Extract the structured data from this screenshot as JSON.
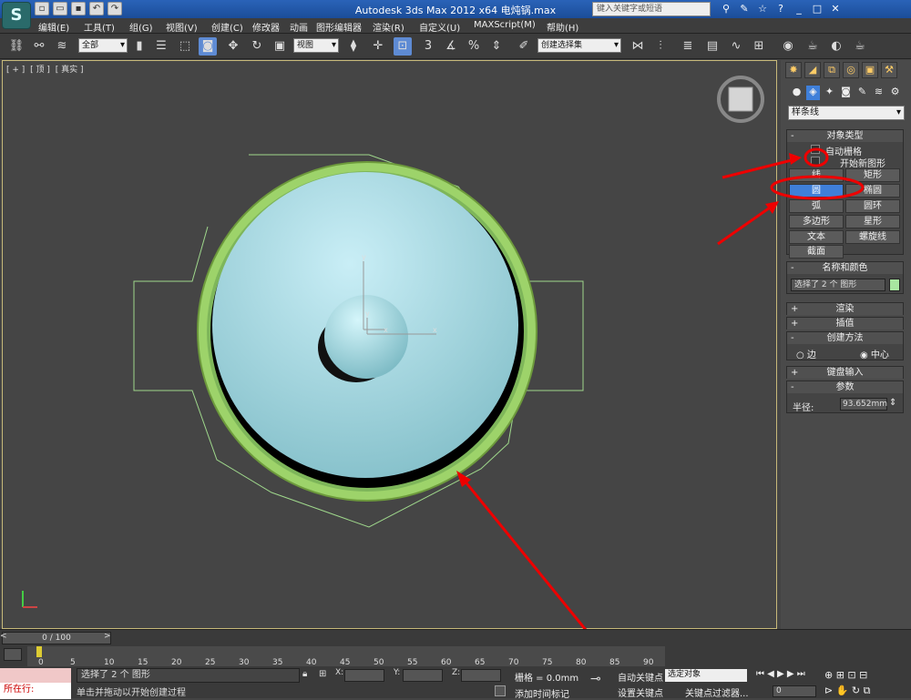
{
  "title": "Autodesk 3ds Max  2012 x64     电炖锅.max",
  "search_placeholder": "键入关键字或短语",
  "menu": [
    "编辑(E)",
    "工具(T)",
    "组(G)",
    "视图(V)",
    "创建(C)",
    "修改器",
    "动画",
    "图形编辑器",
    "渲染(R)",
    "自定义(U)",
    "MAXScript(M)",
    "帮助(H)"
  ],
  "toolbar": {
    "selection_filter": "全部",
    "ref_coord": "视图",
    "named_sel": "创建选择集"
  },
  "viewport": {
    "label": [
      "[ + ]",
      "[ 顶 ]",
      "[ 真实 ]"
    ],
    "axis_y": "y",
    "axis_x": "x"
  },
  "panel": {
    "category": "样条线",
    "object_type": {
      "title": "对象类型",
      "auto_grid": "自动栅格",
      "start_new_shape": "开始新图形",
      "buttons": [
        "线",
        "矩形",
        "圆",
        "椭圆",
        "弧",
        "圆环",
        "多边形",
        "星形",
        "文本",
        "螺旋线",
        "截面"
      ],
      "active": "圆"
    },
    "name_color": {
      "title": "名称和颜色",
      "value": "选择了 2 个 图形",
      "swatch": "#a8e6a0"
    },
    "rollouts": [
      "渲染",
      "插值"
    ],
    "creation": {
      "title": "创建方法",
      "opt1": "边",
      "opt2": "中心"
    },
    "keyboard": "键盘输入",
    "params": {
      "title": "参数",
      "radius_label": "半径:",
      "radius_value": "93.652mm"
    }
  },
  "timeline": {
    "frame": "0 / 100",
    "ticks": [
      "0",
      "5",
      "10",
      "15",
      "20",
      "25",
      "30",
      "35",
      "40",
      "45",
      "50",
      "55",
      "60",
      "65",
      "70",
      "75",
      "80",
      "85",
      "90"
    ]
  },
  "status": {
    "maxscript_label": "",
    "running": "所在行:",
    "prompt1": "选择了 2 个 图形",
    "prompt2": "单击并拖动以开始创建过程",
    "x": "X:",
    "y": "Y:",
    "z": "Z:",
    "grid": "栅格 = 0.0mm",
    "add_tag": "添加时间标记",
    "auto_key": "自动关键点",
    "set_key": "设置关键点",
    "sel_set": "选定对象",
    "key_filter": "关键点过滤器...",
    "frame_field": "0"
  }
}
